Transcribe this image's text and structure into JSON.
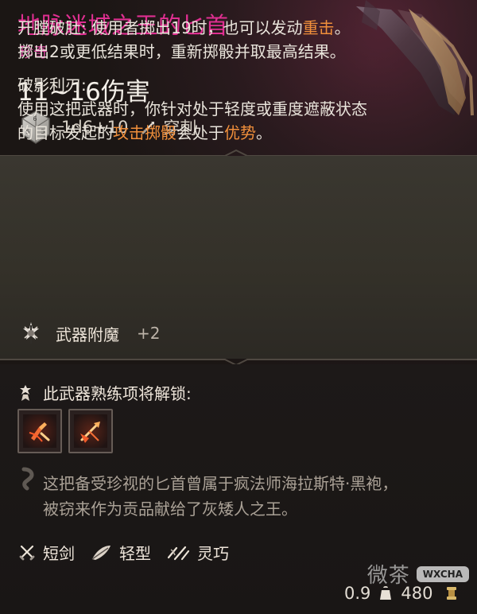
{
  "item": {
    "title": "地脉迷城之王的匕首",
    "rarity": "珍奇",
    "damage": "11~16伤害",
    "roll": "1d6+10",
    "damage_type": "穿刺"
  },
  "effects": {
    "first_name": "开膛破肚",
    "first_colon": ": ",
    "first_text_1": "使用者掷出19时，也可以发动",
    "first_highlight": "重击",
    "first_text_2": "。",
    "first_line_2": "掷出2或更低结果时，重新掷骰并取最高结果。",
    "second_name": "破影利刃:",
    "second_line_1": "使用这把武器时，你针对处于轻度或重度遮蔽状态",
    "second_line_2_prefix": "的目标发起的",
    "second_highlight_1": "攻击掷骰",
    "second_line_2_middle": "会处于",
    "second_highlight_2": "优势",
    "second_line_2_suffix": "。"
  },
  "enchantment": {
    "label": "武器附魔",
    "value": "+2"
  },
  "unlock": {
    "label": "此武器熟练项将解锁:"
  },
  "lore": {
    "line_1": "这把备受珍视的匕首曾属于疯法师海拉斯特·黑袍，",
    "line_2": "被窃来作为贡品献给了灰矮人之王。"
  },
  "tags": [
    {
      "label": "短剑"
    },
    {
      "label": "轻型"
    },
    {
      "label": "灵巧"
    }
  ],
  "footer": {
    "weight": "0.9",
    "price": "480"
  },
  "watermark": {
    "cn": "微茶",
    "en": "WXCHA"
  },
  "colors": {
    "title": "#df2f91",
    "rarity": "#e24ea8",
    "highlight": "#f08f3b"
  },
  "icons": {
    "weapon_art": "dagger-art",
    "dice": "dice-icon",
    "damage_type": "piercing-icon",
    "enchant": "enchant-icon",
    "unlock": "unlock-icon",
    "skill_1": "skill-slash-icon",
    "skill_2": "skill-pierce-icon",
    "lore": "lore-icon",
    "tag_1": "crossed-daggers-icon",
    "tag_2": "feather-icon",
    "tag_3": "agile-icon",
    "weight": "weight-icon",
    "price": "coin-icon"
  }
}
